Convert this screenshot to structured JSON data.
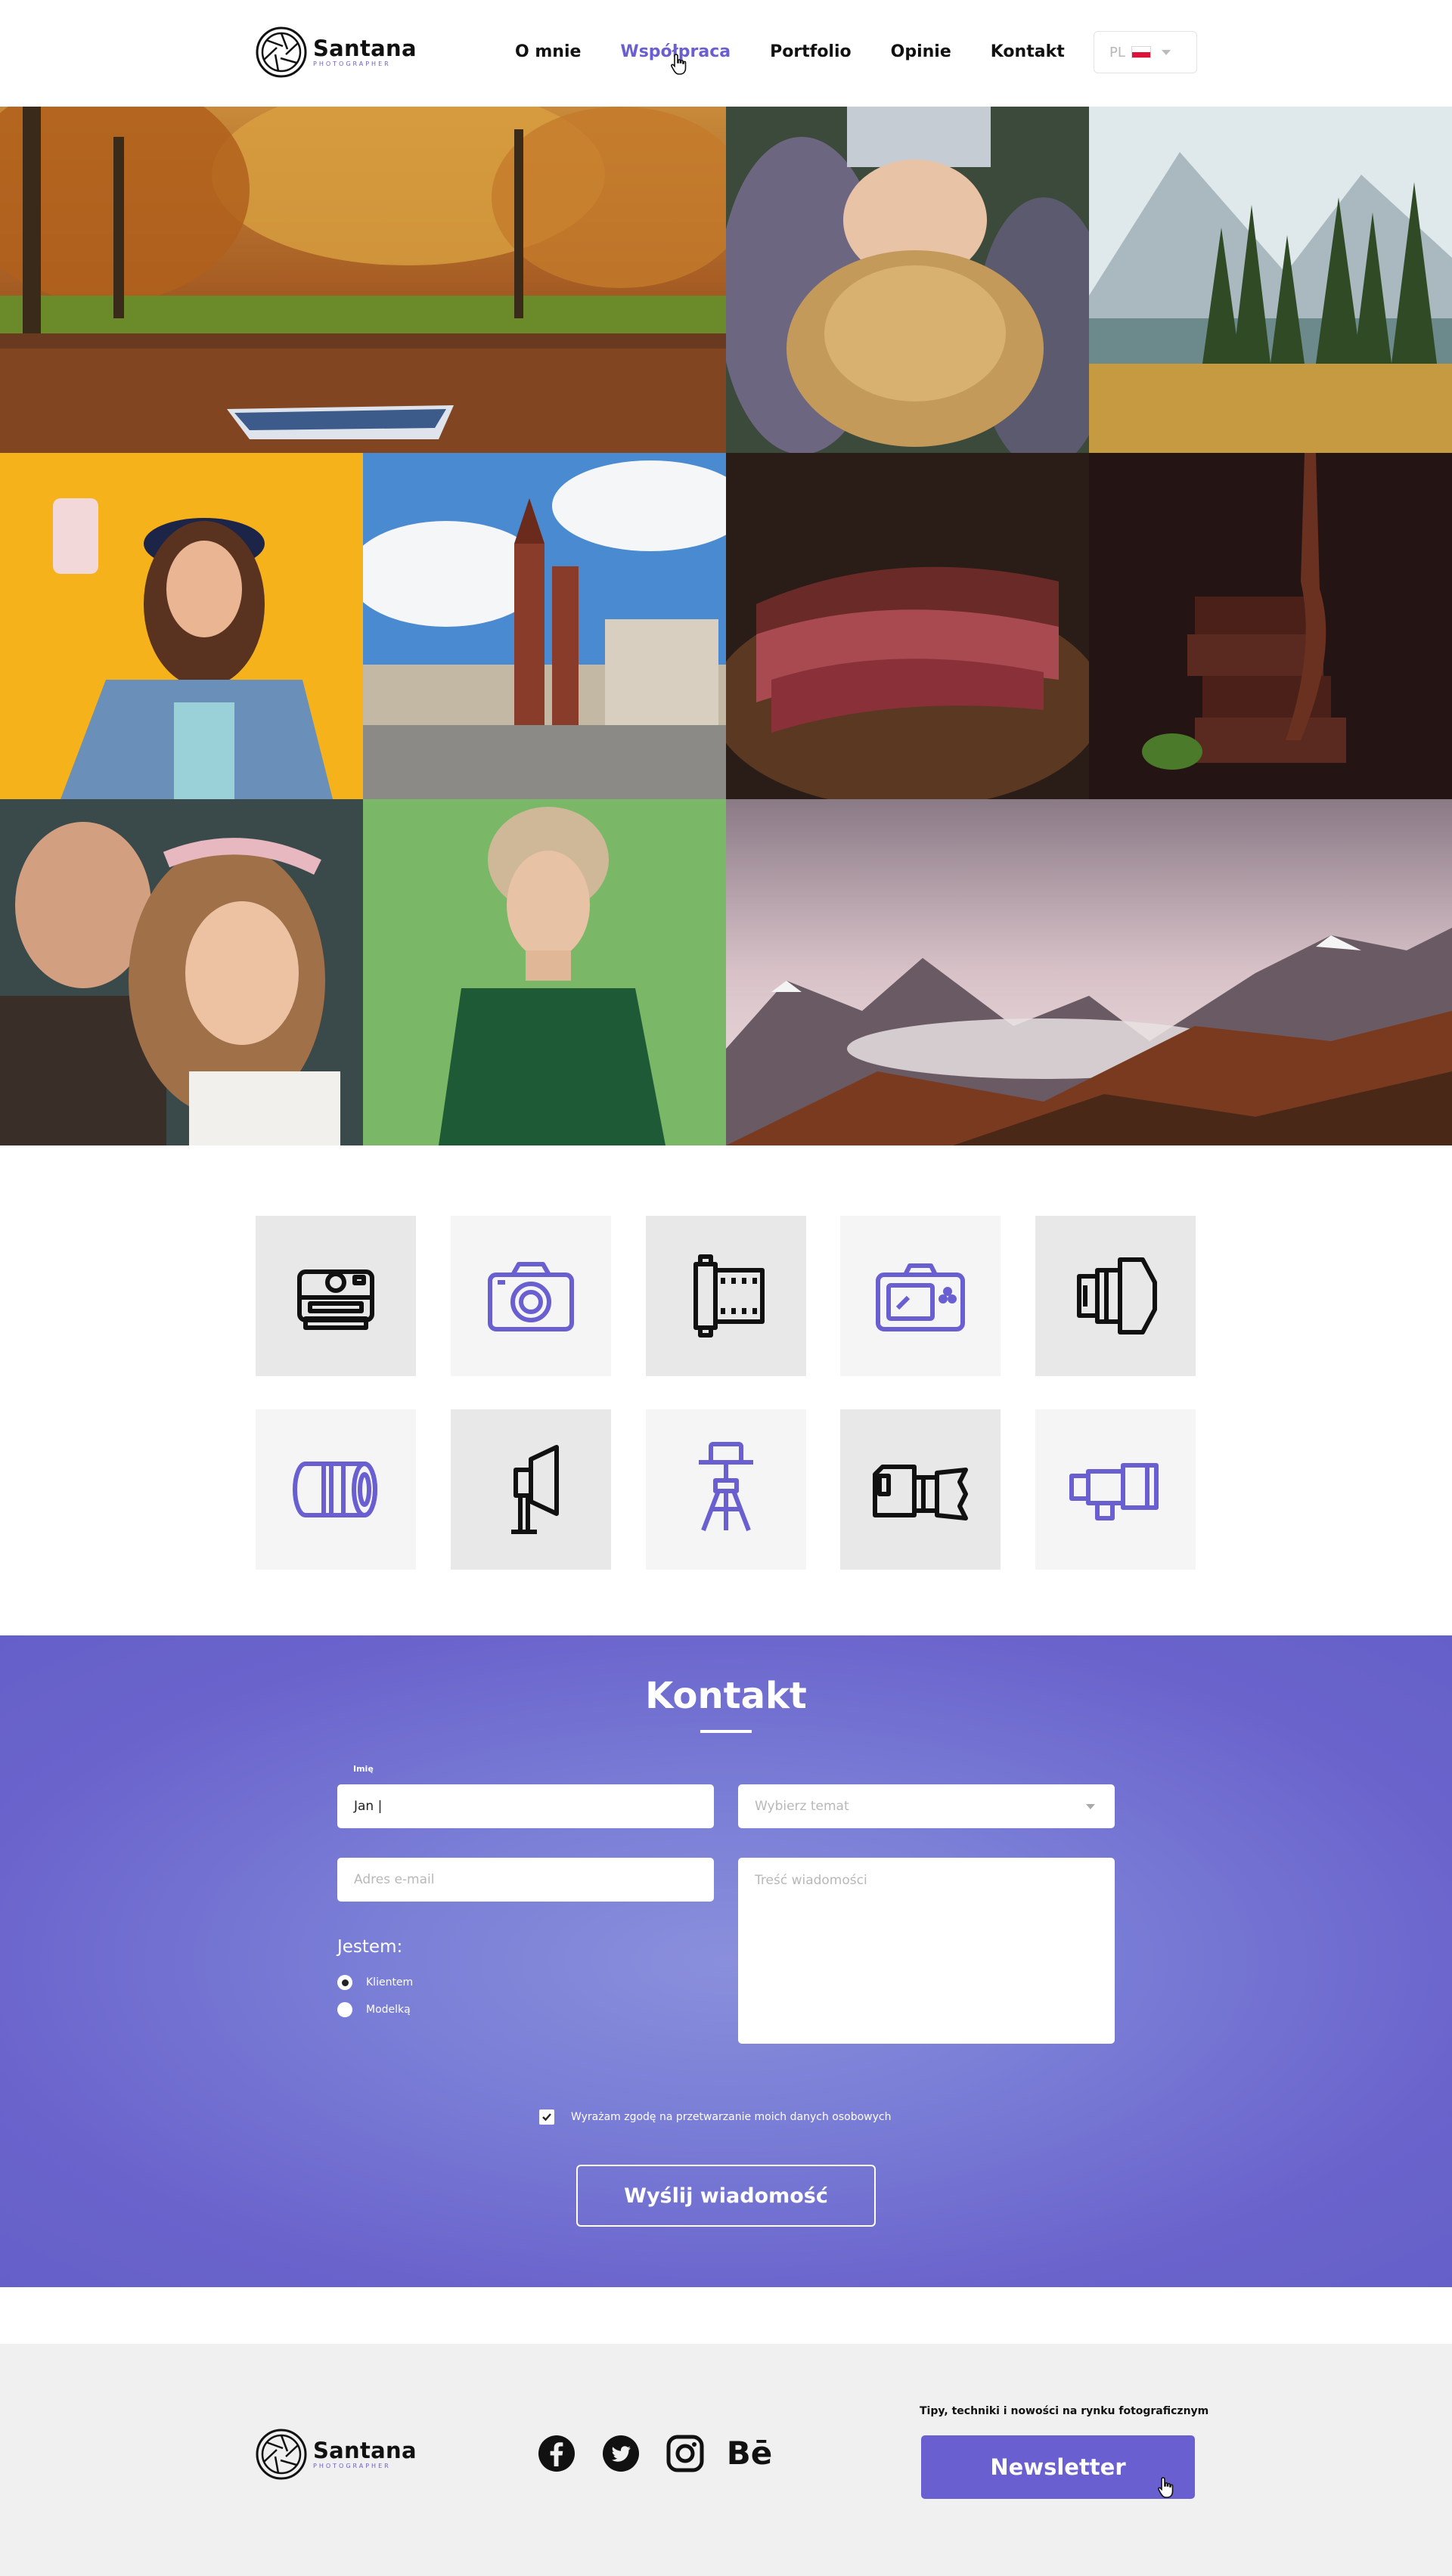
{
  "brand": {
    "name": "Santana",
    "tagline": "PHOTOGRAPHER"
  },
  "nav": {
    "items": [
      {
        "label": "O mnie",
        "active": false
      },
      {
        "label": "Współpraca",
        "active": true
      },
      {
        "label": "Portfolio",
        "active": false
      },
      {
        "label": "Opinie",
        "active": false
      },
      {
        "label": "Kontakt",
        "active": false
      }
    ]
  },
  "language": {
    "code": "PL",
    "flag": "poland-flag-icon"
  },
  "gallery": {
    "photos": [
      "autumn-lake-boat-photo",
      "woman-lavender-hair-photo",
      "mountain-forest-lake-photo",
      "woman-selfie-yellow-photo",
      "krakow-market-square-photo",
      "steak-photo",
      "chocolate-stack-photo",
      "wedding-couple-photo",
      "woman-green-sweater-photo",
      "misty-mountains-photo"
    ]
  },
  "equipment_icons": [
    "instant-camera-icon",
    "camera-icon",
    "film-roll-icon",
    "digital-camera-icon",
    "lens-side-icon",
    "lens-icon",
    "softbox-light-icon",
    "tripod-camera-icon",
    "video-camera-icon",
    "telephoto-lens-icon"
  ],
  "contact": {
    "title": "Kontakt",
    "name_label": "Imię",
    "name_value": "Jan |",
    "topic_placeholder": "Wybierz temat",
    "email_placeholder": "Adres e-mail",
    "message_placeholder": "Treść wiadomości",
    "role_label": "Jestem:",
    "role_options": [
      {
        "label": "Klientem",
        "selected": true
      },
      {
        "label": "Modelką",
        "selected": false
      }
    ],
    "consent_label": "Wyrażam zgodę na przetwarzanie moich danych osobowych",
    "consent_checked": true,
    "submit_label": "Wyślij wiadomość"
  },
  "footer": {
    "social": [
      "facebook-icon",
      "twitter-icon",
      "instagram-icon",
      "behance-icon"
    ],
    "behance_text": "Bē",
    "newsletter_tip": "Tipy, techniki i nowości na rynku fotograficznym",
    "newsletter_button": "Newsletter"
  },
  "colors": {
    "accent": "#6a5fd0",
    "contact_bg": "#6d69d0",
    "footer_bg": "#f0f0f0"
  }
}
